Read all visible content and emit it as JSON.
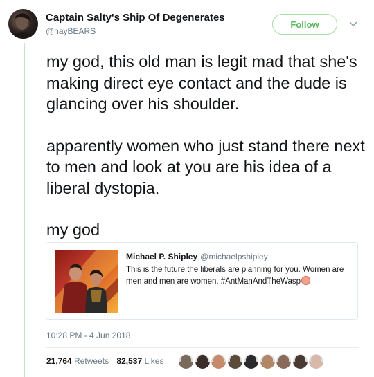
{
  "tweet": {
    "author": {
      "display_name": "Captain Salty's Ship Of Degenerates",
      "handle": "@hayBEARS"
    },
    "follow_label": "Follow",
    "paragraphs": [
      "my god, this old man is legit mad that she's making direct eye contact and the dude is glancing over his shoulder.",
      "apparently women who just stand there next to men and look at you are his idea of a liberal dystopia.",
      "my god"
    ],
    "quoted": {
      "name": "Michael P. Shipley",
      "handle": "@michaelpshipley",
      "text": "This is the future the liberals are planning for you. Women are men and men are women. #AntManAndTheWasp"
    },
    "timestamp": "10:28 PM - 4 Jun 2018",
    "retweets_count": "21,764",
    "retweets_label": "Retweets",
    "likes_count": "82,537",
    "likes_label": "Likes",
    "liker_avatars": [
      "#7a6a5a",
      "#3b2e2a",
      "#c78a6a",
      "#5b4b3b",
      "#2b2b2b",
      "#b08868",
      "#8a6a5a",
      "#4a3a34",
      "#d8b8a8"
    ]
  },
  "colors": {
    "accent_green": "#5cb85c",
    "follow_border": "#a8dba6",
    "muted_text": "#657786",
    "thread_rule": "#c4e5c7"
  }
}
